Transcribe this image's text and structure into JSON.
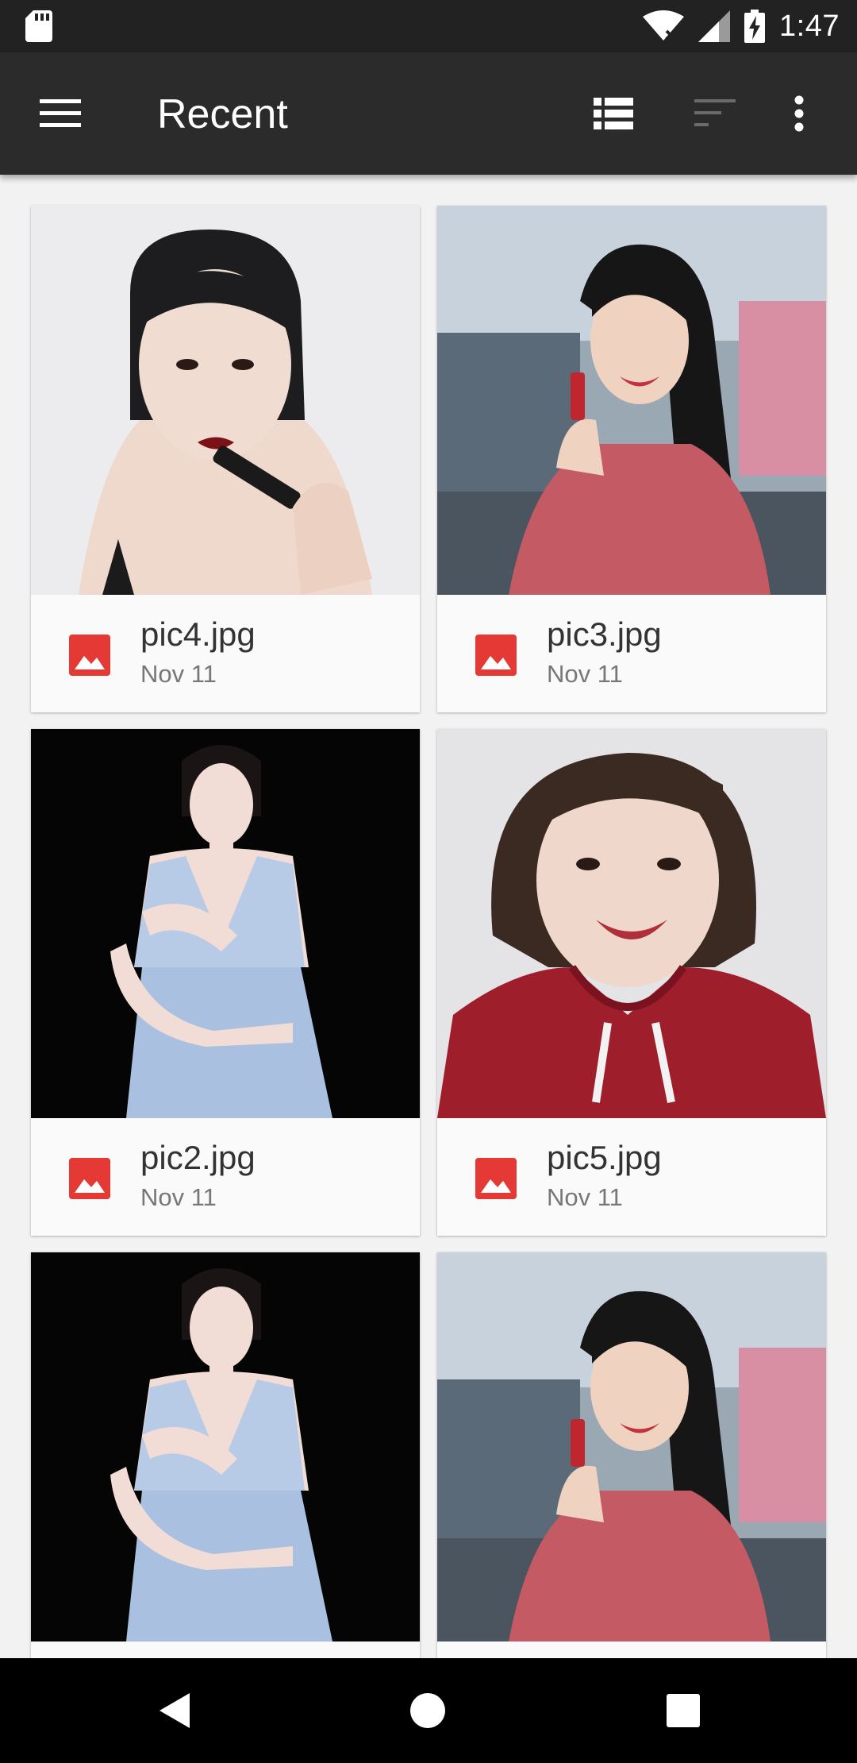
{
  "status_bar": {
    "time": "1:47",
    "icons": [
      "sd-card-icon",
      "wifi-icon",
      "signal-icon",
      "battery-charging-icon"
    ]
  },
  "toolbar": {
    "title": "Recent",
    "icons": [
      "menu-icon",
      "list-view-icon",
      "sort-icon",
      "more-vert-icon"
    ]
  },
  "files": [
    {
      "name": "pic4.jpg",
      "date": "Nov 11",
      "icon": "image-icon"
    },
    {
      "name": "pic3.jpg",
      "date": "Nov 11",
      "icon": "image-icon"
    },
    {
      "name": "pic2.jpg",
      "date": "Nov 11",
      "icon": "image-icon"
    },
    {
      "name": "pic5.jpg",
      "date": "Nov 11",
      "icon": "image-icon"
    },
    {
      "name": "",
      "date": "",
      "icon": "image-icon"
    },
    {
      "name": "",
      "date": "",
      "icon": "image-icon"
    }
  ],
  "nav_bar": {
    "icons": [
      "back-icon",
      "home-icon",
      "recents-icon"
    ]
  },
  "colors": {
    "status_bar": "#222222",
    "toolbar": "#2b2b2b",
    "background": "#f2f2f2",
    "image_icon": "#e53935"
  }
}
